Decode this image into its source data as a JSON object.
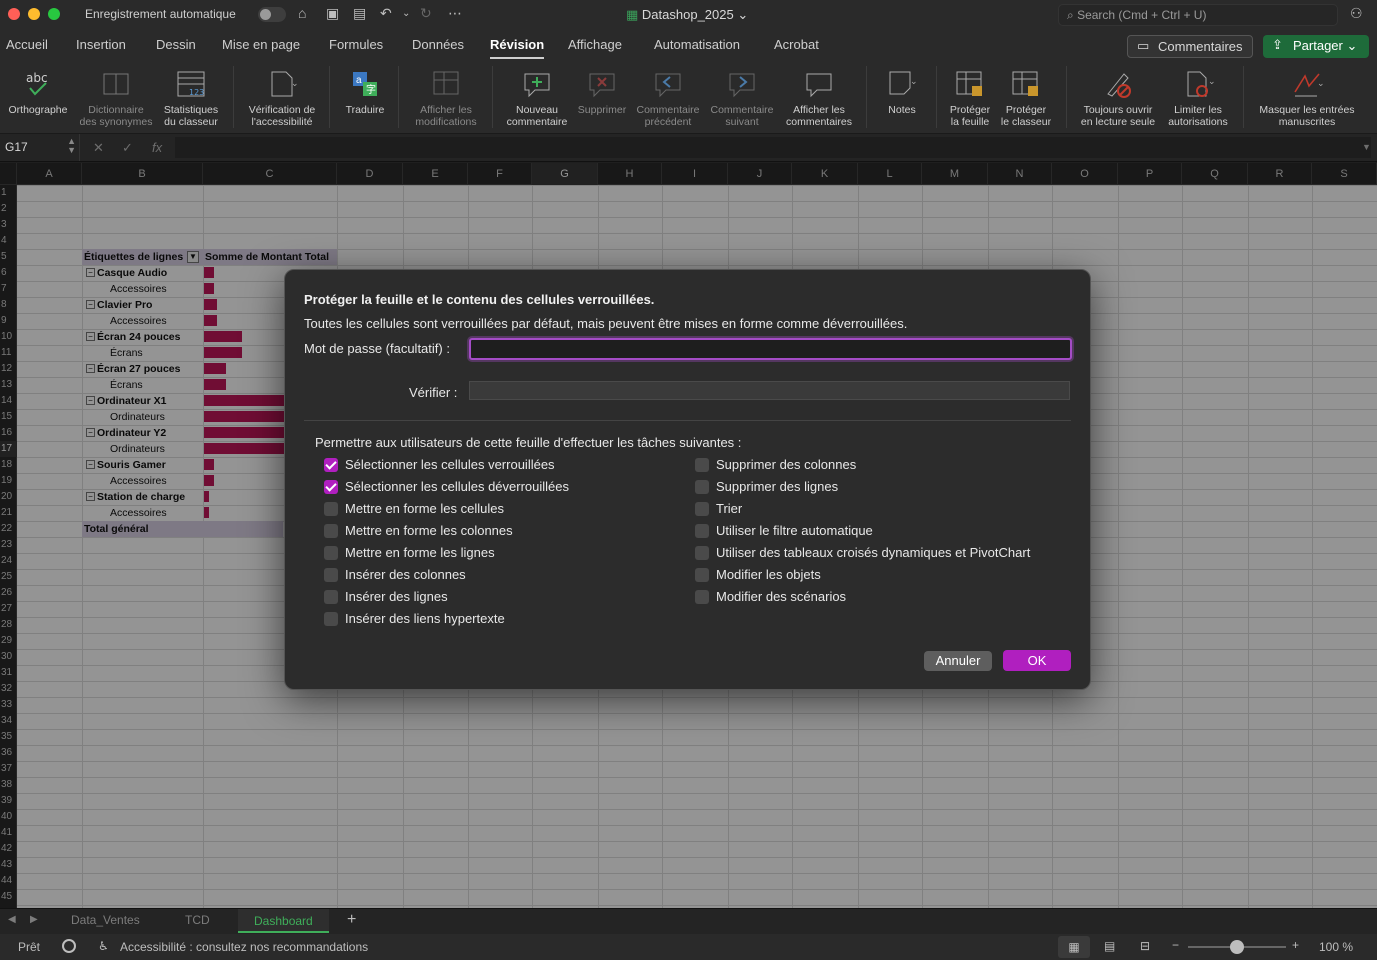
{
  "window": {
    "autosave_label": "Enregistrement automatique",
    "doc_title": "Datashop_2025",
    "search_placeholder": "Search (Cmd + Ctrl + U)"
  },
  "ribbon_tabs": [
    "Accueil",
    "Insertion",
    "Dessin",
    "Mise en page",
    "Formules",
    "Données",
    "Révision",
    "Affichage",
    "Automatisation",
    "Acrobat"
  ],
  "active_tab": "Révision",
  "header_buttons": {
    "comments": "Commentaires",
    "share": "Partager"
  },
  "ribbon": {
    "spelling": "Orthographe",
    "thesaurus_1": "Dictionnaire",
    "thesaurus_2": "des synonymes",
    "stats_1": "Statistiques",
    "stats_2": "du classeur",
    "access_1": "Vérification de",
    "access_2": "l'accessibilité",
    "translate": "Traduire",
    "changes_1": "Afficher les",
    "changes_2": "modifications",
    "newcomment_1": "Nouveau",
    "newcomment_2": "commentaire",
    "delete": "Supprimer",
    "prev_1": "Commentaire",
    "prev_2": "précédent",
    "next_1": "Commentaire",
    "next_2": "suivant",
    "show_1": "Afficher les",
    "show_2": "commentaires",
    "notes": "Notes",
    "protsheet_1": "Protéger",
    "protsheet_2": "la feuille",
    "protbook_1": "Protéger",
    "protbook_2": "le classeur",
    "readonly_1": "Toujours ouvrir",
    "readonly_2": "en lecture seule",
    "perm_1": "Limiter les",
    "perm_2": "autorisations",
    "ink_1": "Masquer les entrées",
    "ink_2": "manuscrites"
  },
  "formula_bar": {
    "cell_ref": "G17",
    "fx": "fx"
  },
  "columns": [
    "A",
    "B",
    "C",
    "D",
    "E",
    "F",
    "G",
    "H",
    "I",
    "J",
    "K",
    "L",
    "M",
    "N",
    "O",
    "P",
    "Q",
    "R",
    "S"
  ],
  "selected_column": "G",
  "rows": [
    "1",
    "2",
    "3",
    "4",
    "5",
    "6",
    "7",
    "8",
    "9",
    "10",
    "11",
    "12",
    "13",
    "14",
    "15",
    "16",
    "17",
    "18",
    "19",
    "20",
    "21",
    "22",
    "23",
    "24",
    "25",
    "26",
    "27",
    "28",
    "29",
    "30",
    "31",
    "32",
    "33",
    "34",
    "35",
    "36",
    "37",
    "38",
    "39",
    "40",
    "41",
    "42",
    "43",
    "44",
    "45"
  ],
  "selected_row": "17",
  "pivot": {
    "header_labels": "Étiquettes de lignes",
    "header_sum": "Somme de Montant Total",
    "total": "Total général",
    "rows": [
      {
        "label": "Casque Audio",
        "level": 0,
        "value": 0.12
      },
      {
        "label": "Accessoires",
        "level": 1,
        "value": 0.12
      },
      {
        "label": "Clavier Pro",
        "level": 0,
        "value": 0.16
      },
      {
        "label": "Accessoires",
        "level": 1,
        "value": 0.16
      },
      {
        "label": "Écran 24 pouces",
        "level": 0,
        "value": 0.48
      },
      {
        "label": "Écrans",
        "level": 1,
        "value": 0.48
      },
      {
        "label": "Écran 27 pouces",
        "level": 0,
        "value": 0.27
      },
      {
        "label": "Écrans",
        "level": 1,
        "value": 0.27
      },
      {
        "label": "Ordinateur X1",
        "level": 0,
        "value": 1.0
      },
      {
        "label": "Ordinateurs",
        "level": 1,
        "value": 1.0
      },
      {
        "label": "Ordinateur Y2",
        "level": 0,
        "value": 1.0
      },
      {
        "label": "Ordinateurs",
        "level": 1,
        "value": 1.0
      },
      {
        "label": "Souris Gamer",
        "level": 0,
        "value": 0.12
      },
      {
        "label": "Accessoires",
        "level": 1,
        "value": 0.12
      },
      {
        "label": "Station de charge",
        "level": 0,
        "value": 0.06
      },
      {
        "label": "Accessoires",
        "level": 1,
        "value": 0.06
      }
    ]
  },
  "dialog": {
    "title": "Protéger la feuille et le contenu des cellules verrouillées.",
    "subtitle": "Toutes les cellules sont verrouillées par défaut, mais peuvent être mises en forme comme déverrouillées.",
    "password_label": "Mot de passe (facultatif) :",
    "verify_label": "Vérifier :",
    "permissions_label": "Permettre aux utilisateurs de cette feuille d'effectuer les tâches suivantes :",
    "options_left": [
      {
        "label": "Sélectionner les cellules verrouillées",
        "checked": true
      },
      {
        "label": "Sélectionner les cellules déverrouillées",
        "checked": true
      },
      {
        "label": "Mettre en forme les cellules",
        "checked": false
      },
      {
        "label": "Mettre en forme les colonnes",
        "checked": false
      },
      {
        "label": "Mettre en forme les lignes",
        "checked": false
      },
      {
        "label": "Insérer des colonnes",
        "checked": false
      },
      {
        "label": "Insérer des lignes",
        "checked": false
      },
      {
        "label": "Insérer des liens hypertexte",
        "checked": false
      }
    ],
    "options_right": [
      {
        "label": "Supprimer des colonnes",
        "checked": false
      },
      {
        "label": "Supprimer des lignes",
        "checked": false
      },
      {
        "label": "Trier",
        "checked": false
      },
      {
        "label": "Utiliser le filtre automatique",
        "checked": false
      },
      {
        "label": "Utiliser des tableaux croisés dynamiques et PivotChart",
        "checked": false
      },
      {
        "label": "Modifier les objets",
        "checked": false
      },
      {
        "label": "Modifier des scénarios",
        "checked": false
      }
    ],
    "cancel": "Annuler",
    "ok": "OK"
  },
  "sheets": [
    "Data_Ventes",
    "TCD",
    "Dashboard"
  ],
  "active_sheet": "Dashboard",
  "add_sheet": "+",
  "status": {
    "ready": "Prêt",
    "accessibility": "Accessibilité : consultez nos recommandations",
    "zoom": "100 %",
    "zoom_level": 0.5
  },
  "colors": {
    "accent": "#b01fbf",
    "bar": "#c2185b",
    "pivot_header": "#d9d0e6",
    "share": "#1e6b3a"
  }
}
